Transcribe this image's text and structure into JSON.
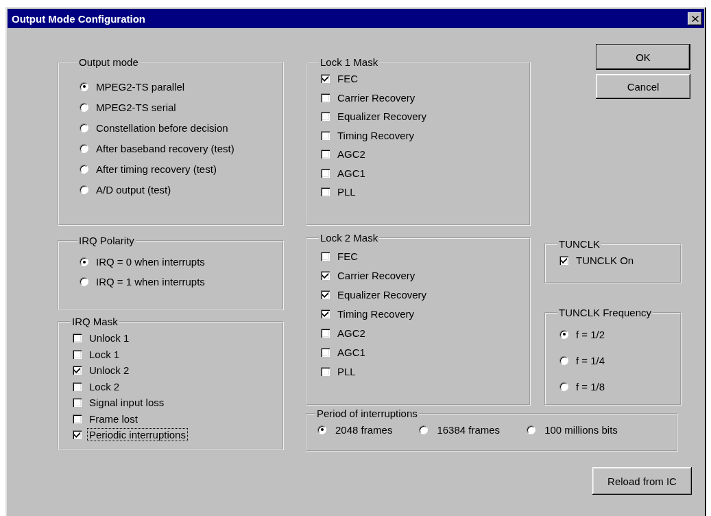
{
  "window": {
    "title": "Output Mode Configuration"
  },
  "output_mode": {
    "label": "Output mode",
    "options": [
      {
        "label": "MPEG2-TS parallel",
        "selected": true
      },
      {
        "label": "MPEG2-TS serial",
        "selected": false
      },
      {
        "label": "Constellation before decision",
        "selected": false
      },
      {
        "label": "After baseband recovery (test)",
        "selected": false
      },
      {
        "label": "After timing recovery (test)",
        "selected": false
      },
      {
        "label": "A/D output (test)",
        "selected": false
      }
    ]
  },
  "irq_polarity": {
    "label": "IRQ Polarity",
    "options": [
      {
        "label": "IRQ = 0 when interrupts",
        "selected": true
      },
      {
        "label": "IRQ = 1 when interrupts",
        "selected": false
      }
    ]
  },
  "irq_mask": {
    "label": "IRQ Mask",
    "items": [
      {
        "label": "Unlock 1",
        "checked": false,
        "focused": false
      },
      {
        "label": "Lock 1",
        "checked": false,
        "focused": false
      },
      {
        "label": "Unlock 2",
        "checked": true,
        "focused": false
      },
      {
        "label": "Lock 2",
        "checked": false,
        "focused": false
      },
      {
        "label": "Signal input loss",
        "checked": false,
        "focused": false
      },
      {
        "label": "Frame lost",
        "checked": false,
        "focused": false
      },
      {
        "label": "Periodic interruptions",
        "checked": true,
        "focused": true
      }
    ]
  },
  "lock1_mask": {
    "label": "Lock 1 Mask",
    "items": [
      {
        "label": "FEC",
        "checked": true,
        "focused": false
      },
      {
        "label": "Carrier Recovery",
        "checked": false,
        "focused": false
      },
      {
        "label": "Equalizer Recovery",
        "checked": false,
        "focused": false
      },
      {
        "label": "Timing Recovery",
        "checked": false,
        "focused": false
      },
      {
        "label": "AGC2",
        "checked": false,
        "focused": false
      },
      {
        "label": "AGC1",
        "checked": false,
        "focused": false
      },
      {
        "label": "PLL",
        "checked": false,
        "focused": false
      }
    ]
  },
  "lock2_mask": {
    "label": "Lock 2 Mask",
    "items": [
      {
        "label": "FEC",
        "checked": false,
        "focused": false
      },
      {
        "label": "Carrier Recovery",
        "checked": true,
        "focused": false
      },
      {
        "label": "Equalizer Recovery",
        "checked": true,
        "focused": false
      },
      {
        "label": "Timing Recovery",
        "checked": true,
        "focused": false
      },
      {
        "label": "AGC2",
        "checked": false,
        "focused": false
      },
      {
        "label": "AGC1",
        "checked": false,
        "focused": false
      },
      {
        "label": "PLL",
        "checked": false,
        "focused": false
      }
    ]
  },
  "buttons": [
    {
      "label": "OK",
      "default": true
    },
    {
      "label": "Cancel",
      "default": false
    }
  ],
  "tunclk": {
    "label": "TUNCLK",
    "items": [
      {
        "label": "TUNCLK On",
        "checked": true,
        "focused": false
      }
    ]
  },
  "tunclk_frequency": {
    "label": "TUNCLK Frequency",
    "options": [
      {
        "label": "f = 1/2",
        "selected": true
      },
      {
        "label": "f = 1/4",
        "selected": false
      },
      {
        "label": "f = 1/8",
        "selected": false
      }
    ]
  },
  "period_of_interruptions": {
    "label": "Period of interruptions",
    "options": [
      {
        "label": "2048 frames",
        "selected": true
      },
      {
        "label": "16384 frames",
        "selected": false
      },
      {
        "label": "100 millions bits",
        "selected": false
      }
    ]
  },
  "reload_button": {
    "label": "Reload from IC",
    "default": false
  }
}
